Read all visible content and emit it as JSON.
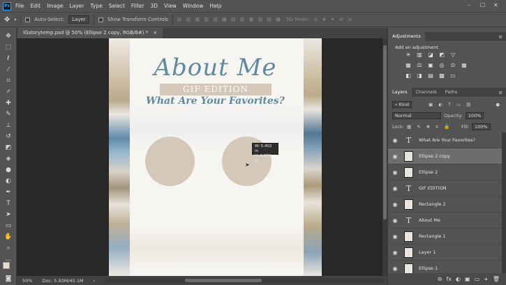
{
  "app": {
    "logo": "Ps",
    "menu": [
      "File",
      "Edit",
      "Image",
      "Layer",
      "Type",
      "Select",
      "Filter",
      "3D",
      "View",
      "Window",
      "Help"
    ],
    "window_controls": [
      "–",
      "☐",
      "✕"
    ]
  },
  "options_bar": {
    "auto_select_label": "Auto-Select:",
    "auto_select_value": "Layer",
    "show_transform_label": "Show Transform Controls",
    "mode_3d_label": "3D Mode:"
  },
  "document": {
    "tab_title": "IGstorytemp.psd @ 50% (Ellipse 2 copy, RGB/8#) *",
    "tab_close": "×",
    "title": "About Me",
    "gif_label": "GIF EDITION",
    "subtitle": "What Are Your Favorites?",
    "tooltip_w": "W:  5.402 in",
    "tooltip_h": "H:  0.000 in",
    "accent_color": "#5e8aa0",
    "shape_color": "#d4c9b8"
  },
  "status": {
    "zoom": "50%",
    "doc": "Doc: 5.93M/45.1M",
    "arrow": "›"
  },
  "adjustments": {
    "tab": "Adjustments",
    "prompt": "Add an adjustment",
    "row1": [
      "☀",
      "▥",
      "◪",
      "◩",
      "▽"
    ],
    "row2": [
      "▦",
      "⚖",
      "▣",
      "◎",
      "⊙",
      "▦"
    ],
    "row3": [
      "◧",
      "◨",
      "▤",
      "▩",
      "▭"
    ]
  },
  "layers_panel": {
    "tabs": [
      "Layers",
      "Channels",
      "Paths"
    ],
    "filter_label": "Kind",
    "blend_mode": "Normal",
    "opacity_label": "Opacity:",
    "opacity_value": "100%",
    "lock_label": "Lock:",
    "fill_label": "Fill:",
    "fill_value": "100%",
    "layers": [
      {
        "name": "What Are Your Favorites?",
        "kind": "text"
      },
      {
        "name": "Ellipse 2 copy",
        "kind": "shape",
        "selected": true
      },
      {
        "name": "Ellipse 2",
        "kind": "shape"
      },
      {
        "name": "GIF EDITION",
        "kind": "text"
      },
      {
        "name": "Rectangle 2",
        "kind": "shape"
      },
      {
        "name": "About Me",
        "kind": "text"
      },
      {
        "name": "Rectangle 1",
        "kind": "shape"
      },
      {
        "name": "Layer 1",
        "kind": "image"
      },
      {
        "name": "Ellipse 1",
        "kind": "shape"
      }
    ],
    "footer_icons": [
      "⊖",
      "fx",
      "◐",
      "▣",
      "▭",
      "+",
      "🗑"
    ]
  }
}
